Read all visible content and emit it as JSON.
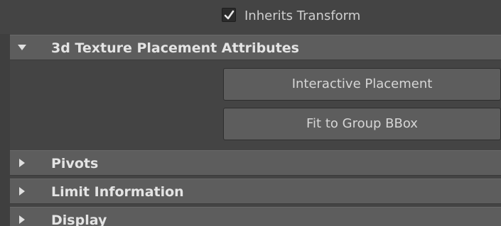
{
  "inherits_transform": {
    "label": "Inherits Transform",
    "checked": true
  },
  "sections": [
    {
      "title": "3d Texture Placement Attributes",
      "expanded": true
    },
    {
      "title": "Pivots",
      "expanded": false
    },
    {
      "title": "Limit Information",
      "expanded": false
    },
    {
      "title": "Display",
      "expanded": false
    }
  ],
  "buttons": {
    "interactive_placement": "Interactive Placement",
    "fit_to_group_bbox": "Fit to Group BBox"
  },
  "colors": {
    "background": "#444444",
    "header": "#5d5d5d",
    "text": "#d8d8d8"
  },
  "icons": {
    "expanded": "triangle-down-icon",
    "collapsed": "triangle-right-icon",
    "check": "checkmark-icon"
  }
}
